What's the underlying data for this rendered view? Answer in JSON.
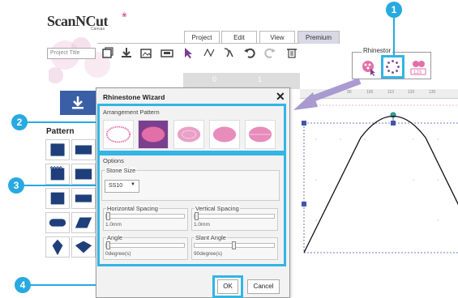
{
  "app": {
    "logo_main": "ScanNCut",
    "logo_sub": "Canvas",
    "tabs": [
      "Project",
      "Edit",
      "View",
      "Premium"
    ],
    "project_title_placeholder": "Project Title"
  },
  "rhinestone_panel": {
    "label": "Rhinestor"
  },
  "ruler": {
    "top_marks": [
      "0",
      "1"
    ],
    "canvas_marks": [
      "80",
      "90",
      "100",
      "110",
      "120",
      "130"
    ]
  },
  "left_panel": {
    "pattern_title": "Pattern"
  },
  "dialog": {
    "title": "Rhinestone Wizard",
    "arrangement_label": "Arrangement Pattern",
    "options_label": "Options",
    "stone_size_label": "Stone Size",
    "stone_size_value": "SS10",
    "horizontal_spacing_label": "Horizontal Spacing",
    "horizontal_spacing_value": "1.0mm",
    "vertical_spacing_label": "Vertical Spacing",
    "vertical_spacing_value": "1.0mm",
    "angle_label": "Angle",
    "angle_value": "0degree(s)",
    "slant_angle_label": "Slant Angle",
    "slant_angle_value": "90degree(s)",
    "ok_label": "OK",
    "cancel_label": "Cancel"
  },
  "callouts": [
    "1",
    "2",
    "3",
    "4"
  ],
  "colors": {
    "accent_blue": "#27a9e1",
    "selected_purple": "#7b3f8f",
    "rhinestone_pink": "#e36fa8",
    "nav_blue": "#3b5fa6"
  }
}
